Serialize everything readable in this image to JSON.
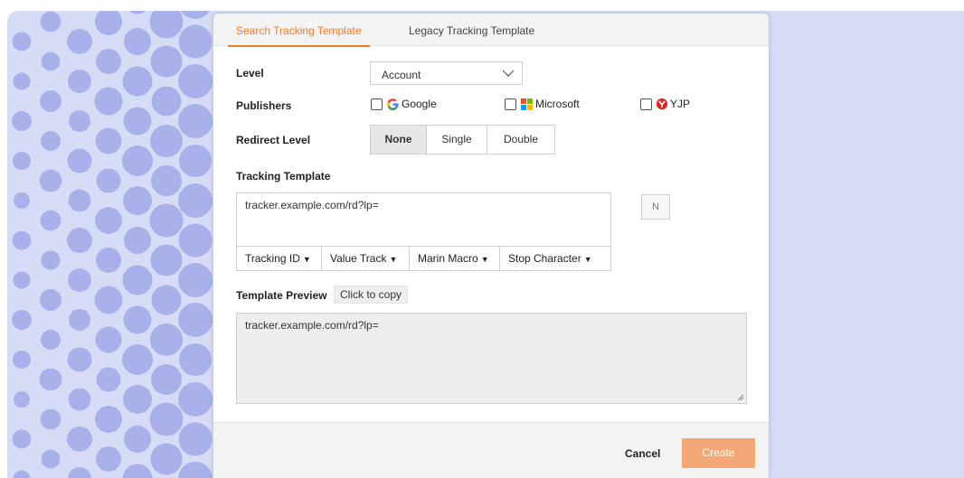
{
  "tabs": [
    {
      "label": "Search Tracking Template",
      "active": true
    },
    {
      "label": "Legacy Tracking Template",
      "active": false
    }
  ],
  "form": {
    "level_label": "Level",
    "level_value": "Account",
    "publishers_label": "Publishers",
    "publishers": [
      {
        "name": "Google",
        "icon": "google-logo-icon",
        "checked": false
      },
      {
        "name": "Microsoft",
        "icon": "microsoft-logo-icon",
        "checked": false
      },
      {
        "name": "YJP",
        "icon": "yahoo-japan-logo-icon",
        "checked": false
      }
    ],
    "redirect_label": "Redirect Level",
    "redirect_options": [
      "None",
      "Single",
      "Double"
    ],
    "redirect_selected": "None",
    "tracking_label": "Tracking Template",
    "tracking_value": "tracker.example.com/rd?lp=",
    "macros": [
      "Tracking ID",
      "Value Track",
      "Marin Macro",
      "Stop Character"
    ],
    "n_button": "N",
    "preview_label": "Template Preview",
    "copy_label": "Click to copy",
    "preview_value": "tracker.example.com/rd?lp="
  },
  "footer": {
    "cancel_label": "Cancel",
    "create_label": "Create"
  },
  "colors": {
    "accent": "#f07b2a",
    "create_button": "#f4a877",
    "background_panel": "#d7dcf6",
    "dots": "#a9b1ea"
  }
}
